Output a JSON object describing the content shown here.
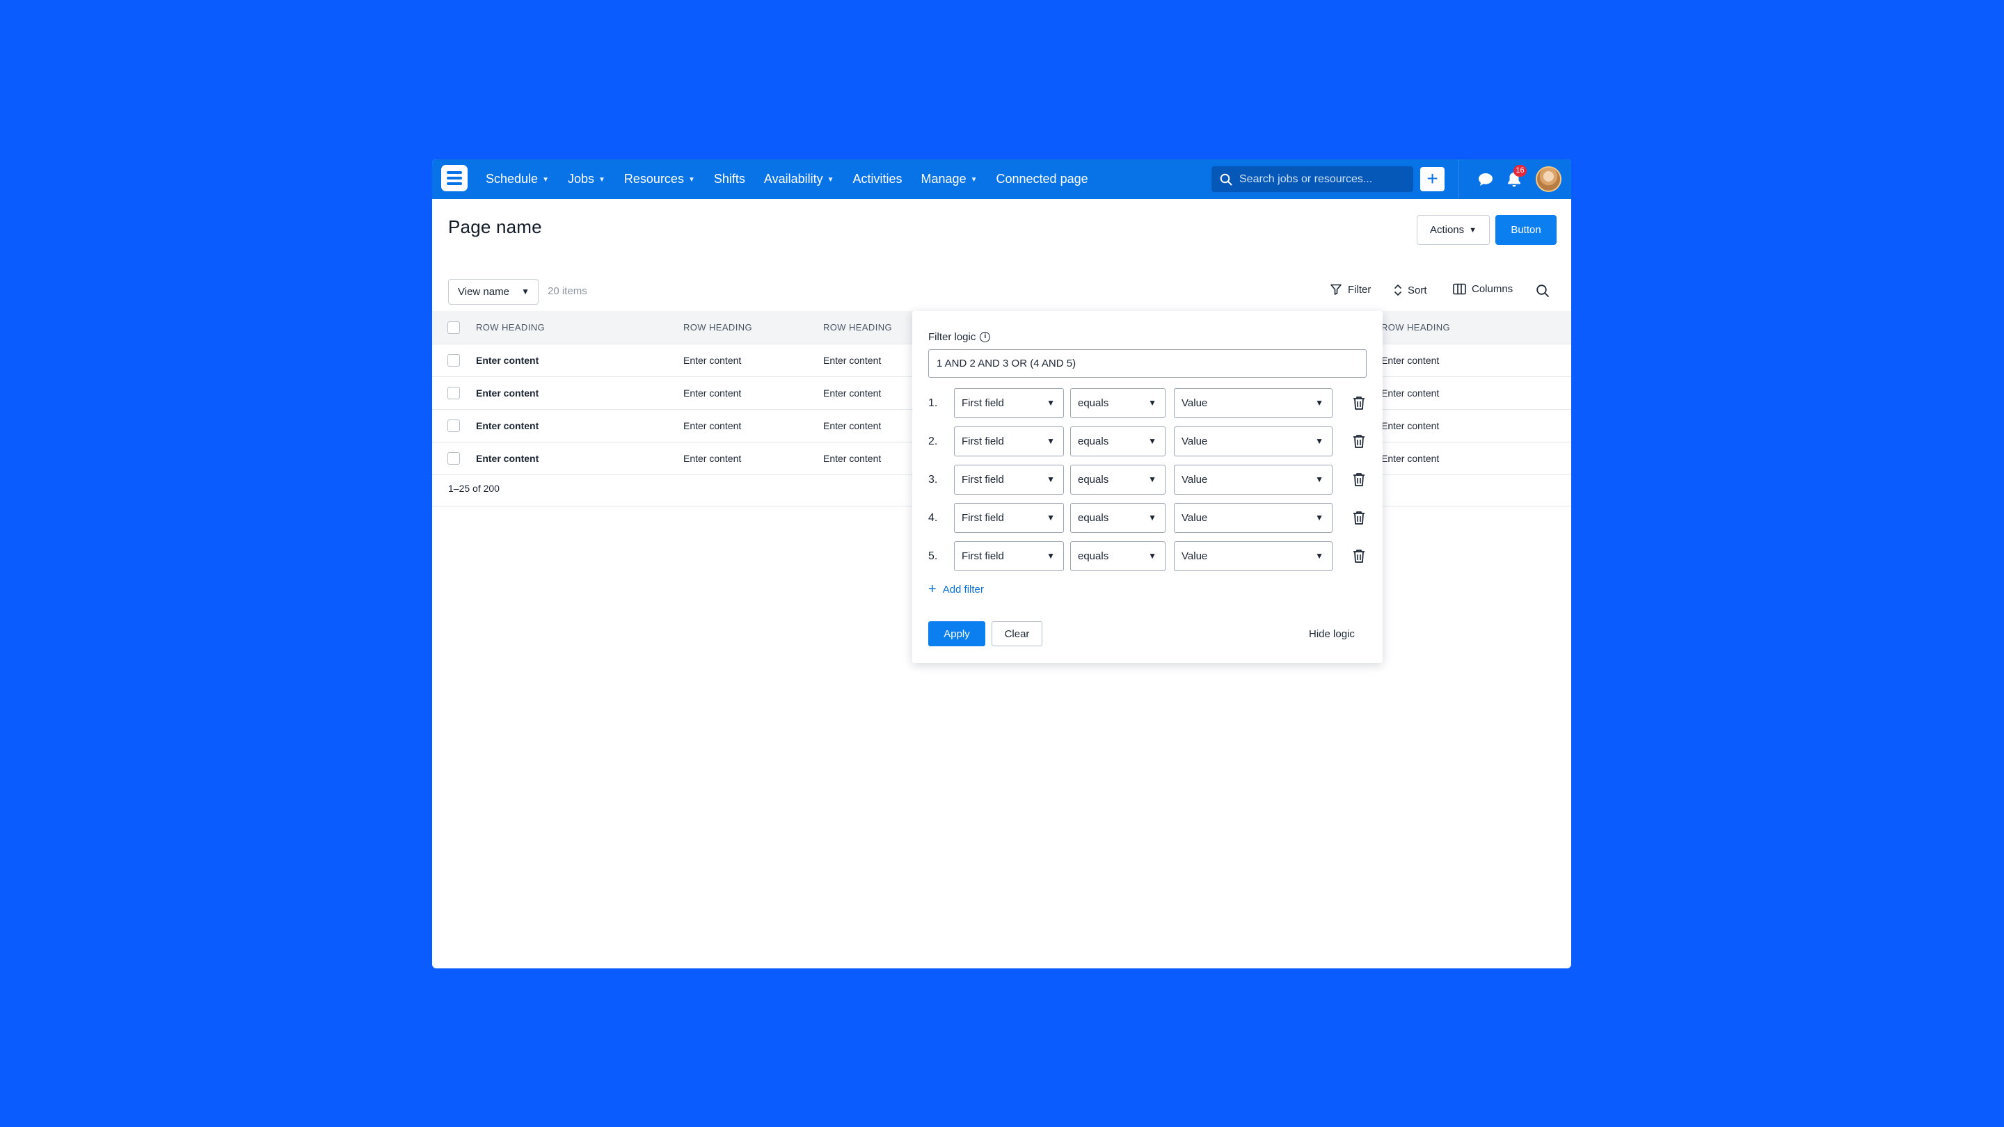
{
  "nav": {
    "items": [
      {
        "label": "Schedule",
        "dropdown": true
      },
      {
        "label": "Jobs",
        "dropdown": true
      },
      {
        "label": "Resources",
        "dropdown": true
      },
      {
        "label": "Shifts",
        "dropdown": false
      },
      {
        "label": "Availability",
        "dropdown": true
      },
      {
        "label": "Activities",
        "dropdown": false
      },
      {
        "label": "Manage",
        "dropdown": true
      },
      {
        "label": "Connected page",
        "dropdown": false
      }
    ],
    "search_placeholder": "Search jobs or resources...",
    "notification_count": "16",
    "icons": [
      "logo-icon",
      "search-icon",
      "plus-icon",
      "chat-icon",
      "bell-icon",
      "avatar"
    ],
    "accent_color": "#0873e6"
  },
  "header": {
    "title": "Page name",
    "actions_label": "Actions",
    "button_label": "Button"
  },
  "toolbar": {
    "view_name": "View name",
    "item_count": "20 items",
    "filter_label": "Filter",
    "sort_label": "Sort",
    "columns_label": "Columns"
  },
  "table": {
    "headers": [
      "ROW HEADING",
      "ROW HEADING",
      "ROW HEADING",
      "ROW HEADING"
    ],
    "rows": [
      [
        "Enter content",
        "Enter content",
        "Enter content",
        "Enter content"
      ],
      [
        "Enter content",
        "Enter content",
        "Enter content",
        "Enter content"
      ],
      [
        "Enter content",
        "Enter content",
        "Enter content",
        "Enter content"
      ],
      [
        "Enter content",
        "Enter content",
        "Enter content",
        "Enter content"
      ]
    ],
    "pagination": "1–25 of 200"
  },
  "filter_panel": {
    "logic_label": "Filter logic",
    "logic_value": "1 AND 2 AND 3 OR (4 AND 5)",
    "rows": [
      {
        "num": "1.",
        "field": "First field",
        "operator": "equals",
        "value": "Value"
      },
      {
        "num": "2.",
        "field": "First field",
        "operator": "equals",
        "value": "Value"
      },
      {
        "num": "3.",
        "field": "First field",
        "operator": "equals",
        "value": "Value"
      },
      {
        "num": "4.",
        "field": "First field",
        "operator": "equals",
        "value": "Value"
      },
      {
        "num": "5.",
        "field": "First field",
        "operator": "equals",
        "value": "Value"
      }
    ],
    "add_filter_label": "Add filter",
    "apply_label": "Apply",
    "clear_label": "Clear",
    "hide_logic_label": "Hide logic"
  }
}
